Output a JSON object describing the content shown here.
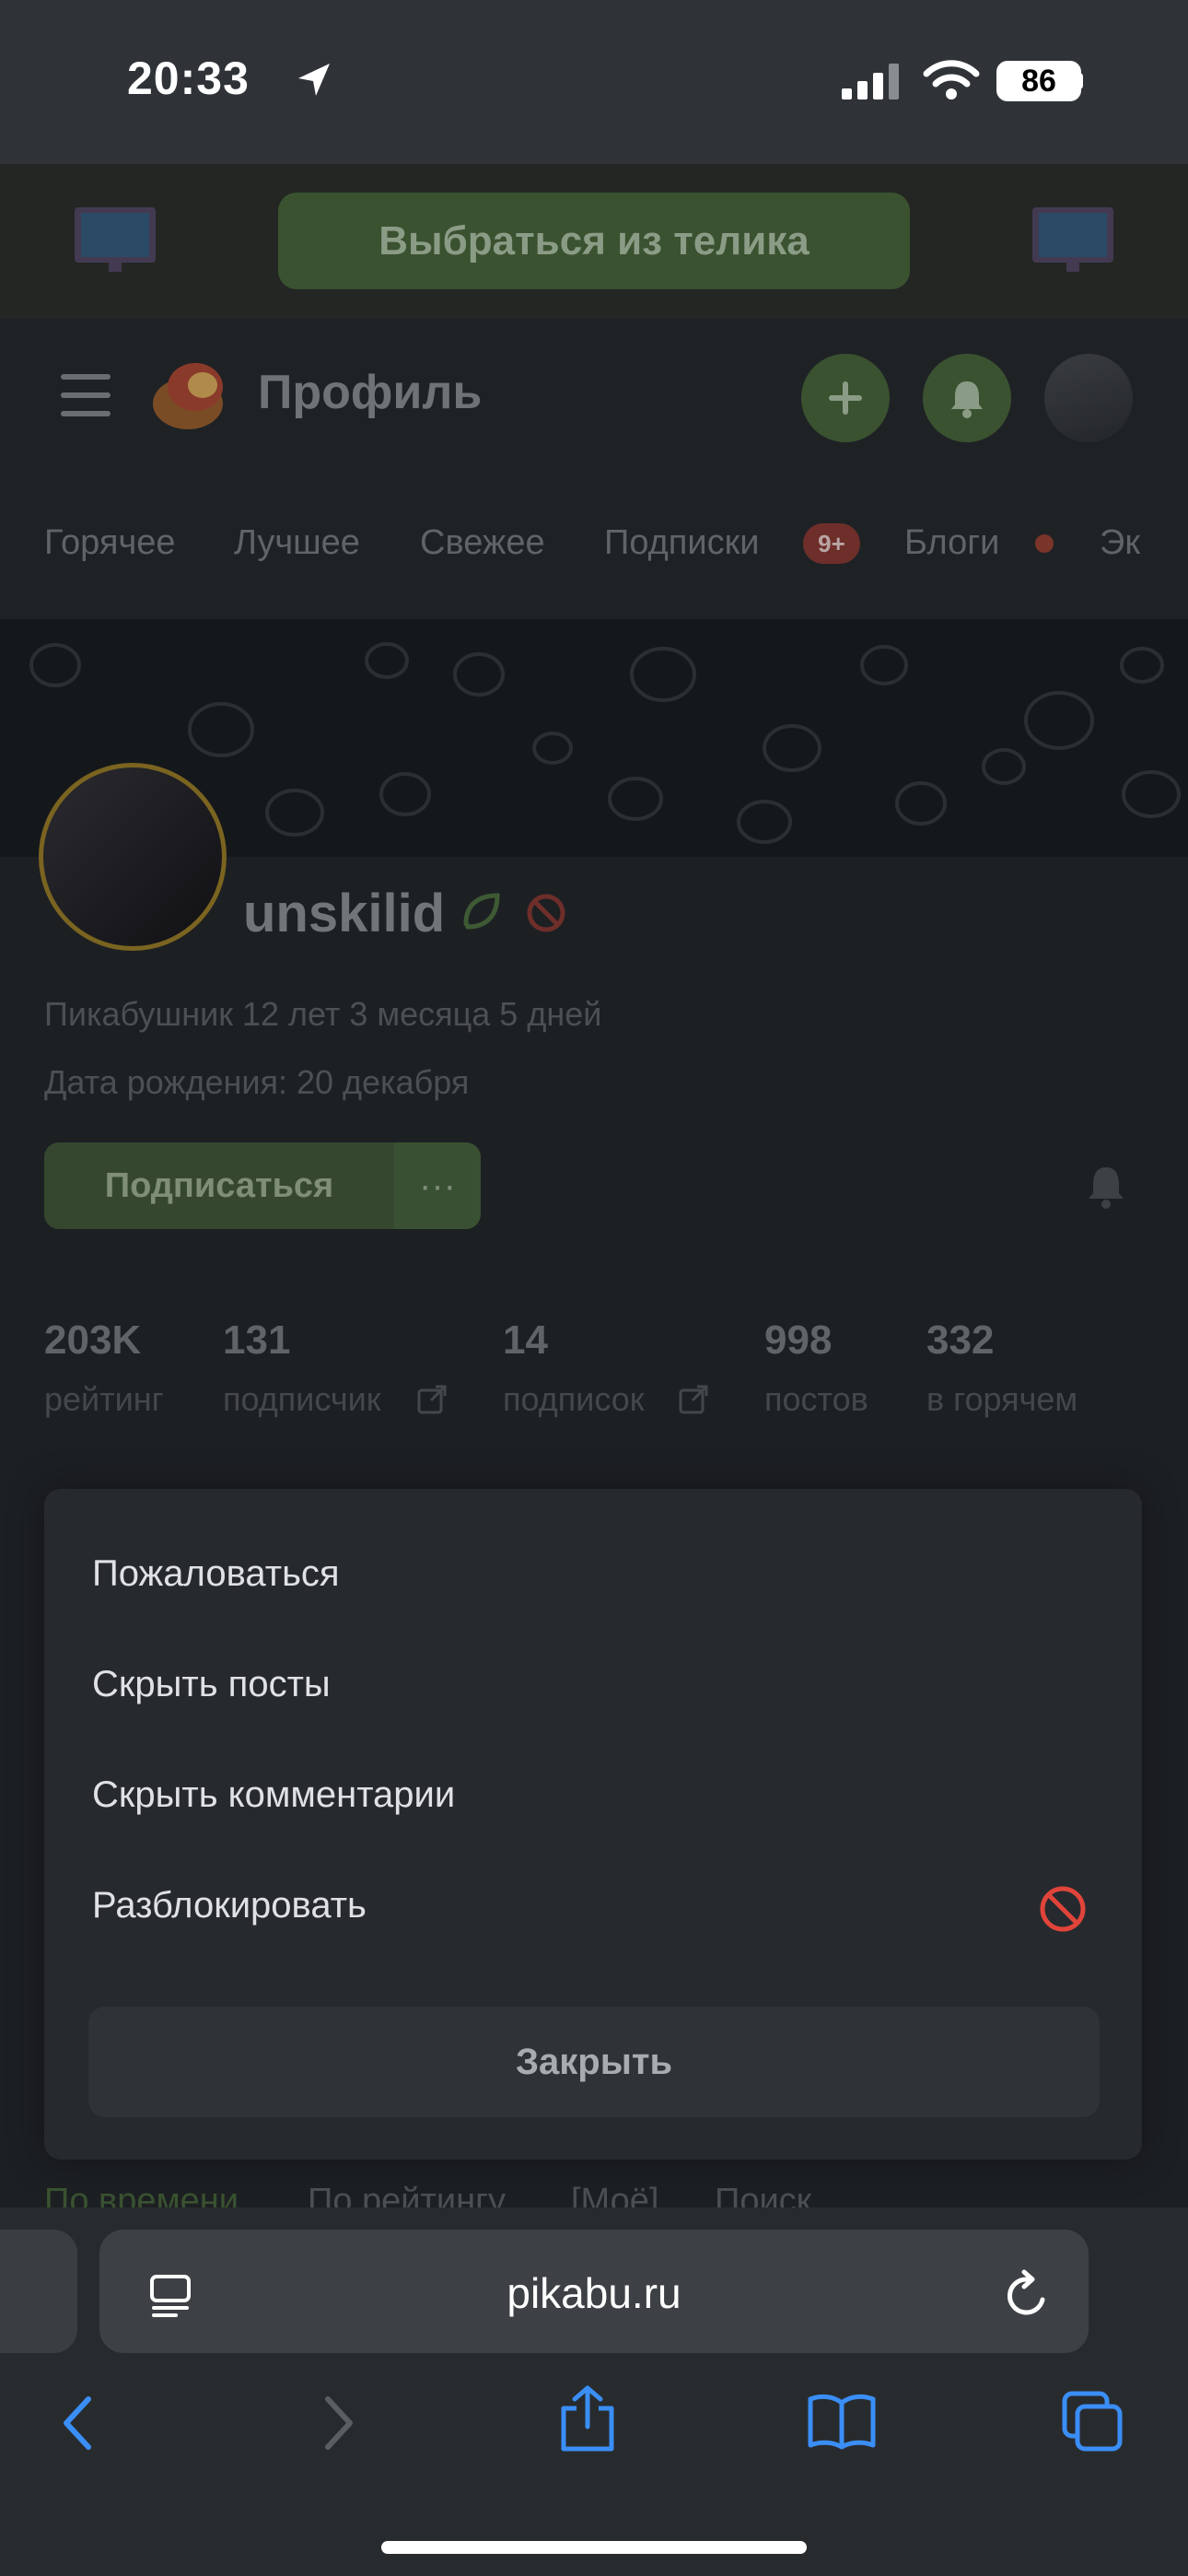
{
  "status_bar": {
    "time": "20:33",
    "battery": "86"
  },
  "promo": {
    "button_label": "Выбраться из телика"
  },
  "header": {
    "title": "Профиль"
  },
  "nav_tabs": {
    "hot": "Горячее",
    "best": "Лучшее",
    "fresh": "Свежее",
    "subs": "Подписки",
    "subs_badge": "9+",
    "blogs": "Блоги",
    "more": "Эк"
  },
  "profile": {
    "username": "unskilid",
    "tenure": "Пикабушник 12 лет 3 месяца 5 дней",
    "birthday": "Дата рождения: 20 декабря",
    "subscribe_label": "Подписаться",
    "more_label": "···"
  },
  "stats": [
    {
      "value": "203K",
      "label": "рейтинг"
    },
    {
      "value": "131",
      "label": "подписчик"
    },
    {
      "value": "14",
      "label": "подписок"
    },
    {
      "value": "998",
      "label": "постов"
    },
    {
      "value": "332",
      "label": "в горячем"
    }
  ],
  "sort_tabs": {
    "by_time": "По времени",
    "by_rating": "По рейтингу",
    "mine": "[Моё]",
    "search": "Поиск"
  },
  "action_sheet": {
    "report": "Пожаловаться",
    "hide_posts": "Скрыть посты",
    "hide_comments": "Скрыть комментарии",
    "unblock": "Разблокировать",
    "close": "Закрыть"
  },
  "browser": {
    "url": "pikabu.ru"
  },
  "colors": {
    "accent_green": "#3a5230",
    "danger_red": "#e0443a",
    "safari_blue": "#3a8ef6"
  },
  "icons": [
    "location-arrow-icon",
    "cellular-icon",
    "wifi-icon",
    "tv-icon",
    "menu-icon",
    "pikabu-logo-icon",
    "plus-icon",
    "bell-icon",
    "block-icon",
    "external-link-icon",
    "reader-icon",
    "reload-icon",
    "back-icon",
    "forward-icon",
    "share-icon",
    "bookmarks-icon",
    "tabs-icon"
  ]
}
